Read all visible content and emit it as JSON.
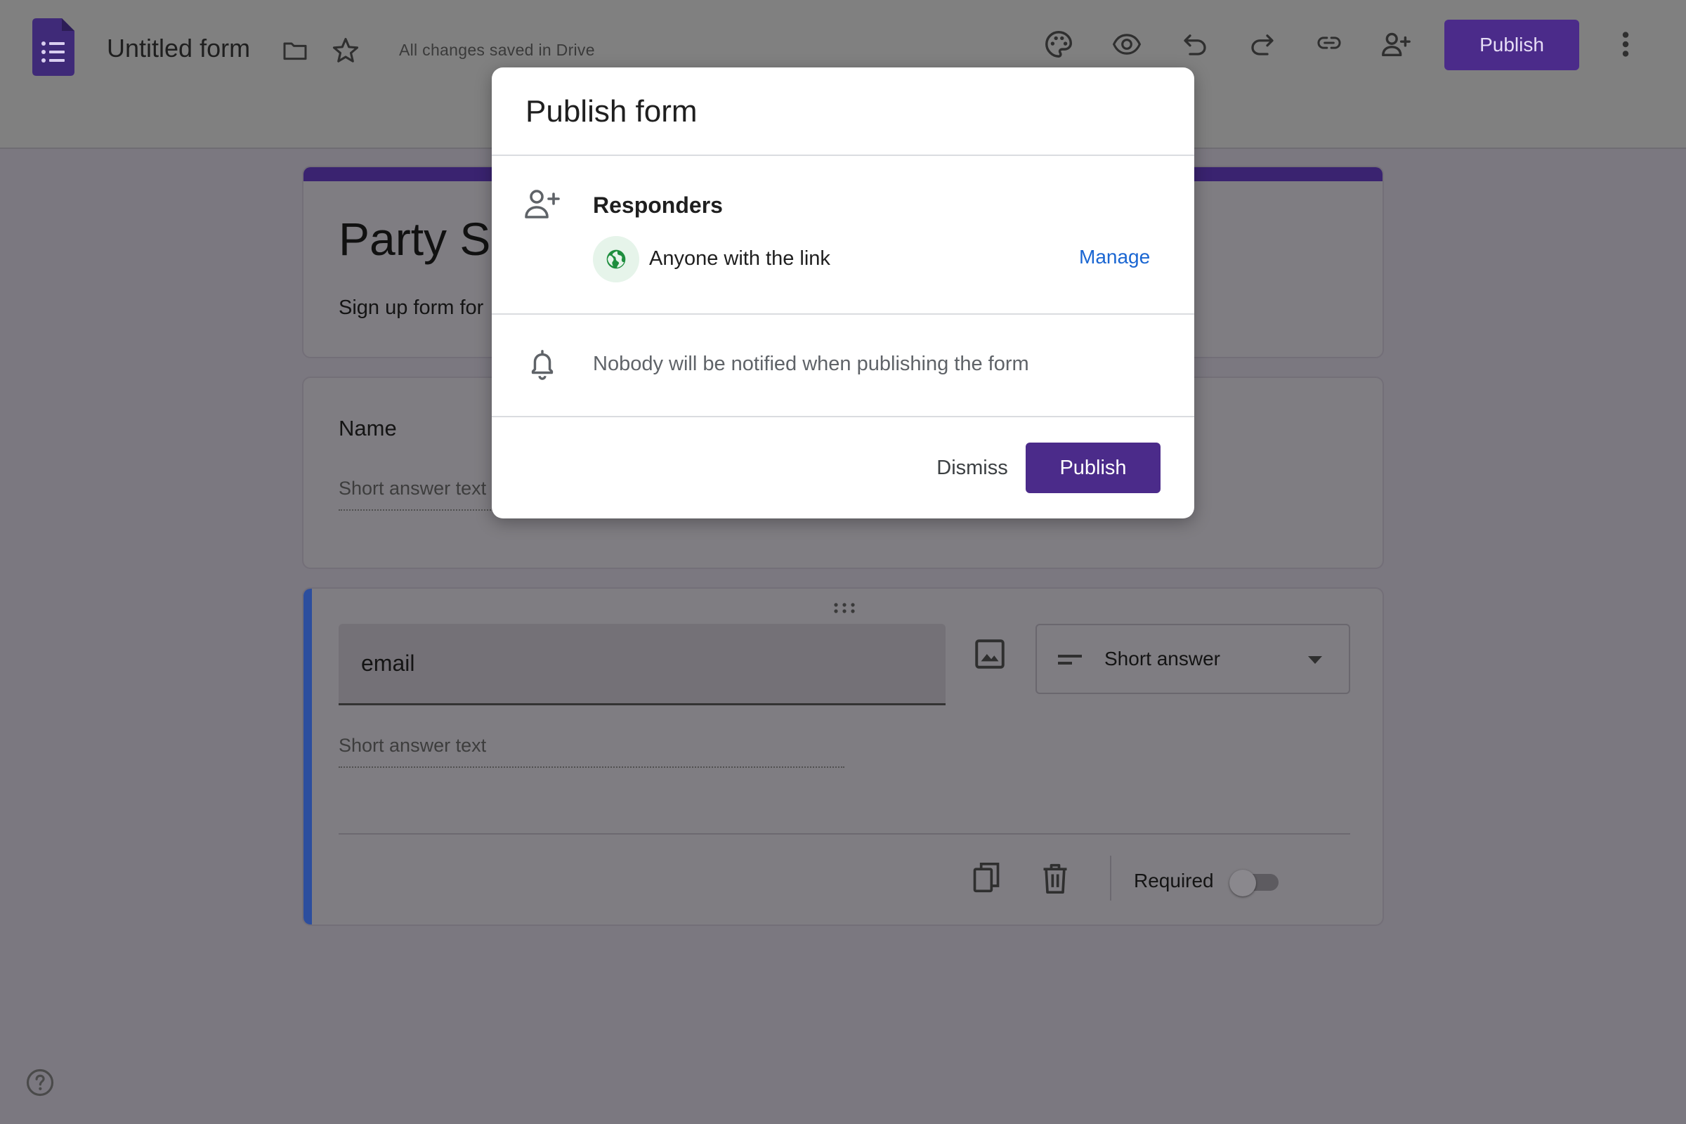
{
  "header": {
    "title": "Untitled form",
    "save_status": "All changes saved in Drive",
    "publish_label": "Publish",
    "icons": [
      "forms-logo-icon",
      "folder-icon",
      "star-icon",
      "palette-icon",
      "preview-eye-icon",
      "undo-icon",
      "redo-icon",
      "link-icon",
      "add-collaborator-icon",
      "more-vert-icon"
    ]
  },
  "form": {
    "title": "Party Si",
    "description": "Sign up form for",
    "questions": [
      {
        "title": "Name",
        "placeholder": "Short answer text"
      },
      {
        "title": "email",
        "placeholder": "Short answer text",
        "type": "Short answer",
        "required_label": "Required",
        "required": false
      }
    ]
  },
  "dialog": {
    "title": "Publish form",
    "responders_label": "Responders",
    "access_label": "Anyone with the link",
    "manage_label": "Manage",
    "notify_text": "Nobody will be notified when publishing the form",
    "dismiss_label": "Dismiss",
    "publish_label": "Publish"
  },
  "colors": {
    "brand_purple": "#4b2b8a",
    "link_blue": "#1a66d2",
    "globe_green": "#1e8e3e",
    "active_card_accent": "#2c4e9e"
  }
}
